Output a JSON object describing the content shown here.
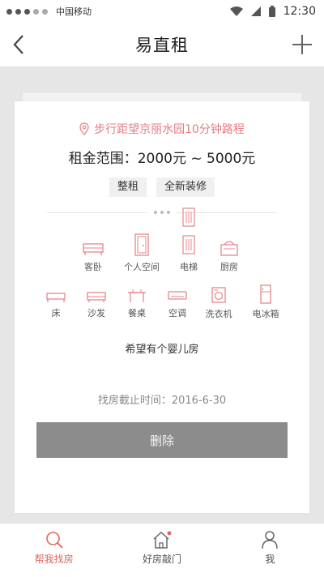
{
  "status_bar": {
    "carrier": "中国移动",
    "time": "12:30"
  },
  "header": {
    "title": "易直租"
  },
  "card": {
    "location": "步行距望京丽水园10分钟路程",
    "rent": "租金范围：2000元 ~ 5000元",
    "tags": [
      "整租",
      "全新装修"
    ],
    "amenities_row1": [
      {
        "label": "客卧",
        "icon": "sofa-bed-icon"
      },
      {
        "label": "个人空间",
        "icon": "door-icon"
      },
      {
        "label": "电梯",
        "icon": "elevator-icon"
      },
      {
        "label": "厨房",
        "icon": "stove-icon"
      }
    ],
    "amenities_row2": [
      {
        "label": "床",
        "icon": "bed-icon"
      },
      {
        "label": "沙发",
        "icon": "sofa-icon"
      },
      {
        "label": "餐桌",
        "icon": "dining-table-icon"
      },
      {
        "label": "空调",
        "icon": "air-conditioner-icon"
      },
      {
        "label": "洗衣机",
        "icon": "washing-machine-icon"
      },
      {
        "label": "电冰箱",
        "icon": "fridge-icon"
      }
    ],
    "wish": "希望有个婴儿房",
    "deadline": "找房截止时间：2016-6-30",
    "delete_label": "删除"
  },
  "bottom_nav": [
    {
      "label": "帮我找房",
      "icon": "search-icon",
      "active": true
    },
    {
      "label": "好房敲门",
      "icon": "house-icon",
      "active": false
    },
    {
      "label": "我",
      "icon": "user-icon",
      "active": false
    }
  ],
  "colors": {
    "accent": "#e0665f",
    "icon_pink": "#e6878b",
    "button_gray": "#8c8c8c",
    "background": "#e6e6e6"
  }
}
